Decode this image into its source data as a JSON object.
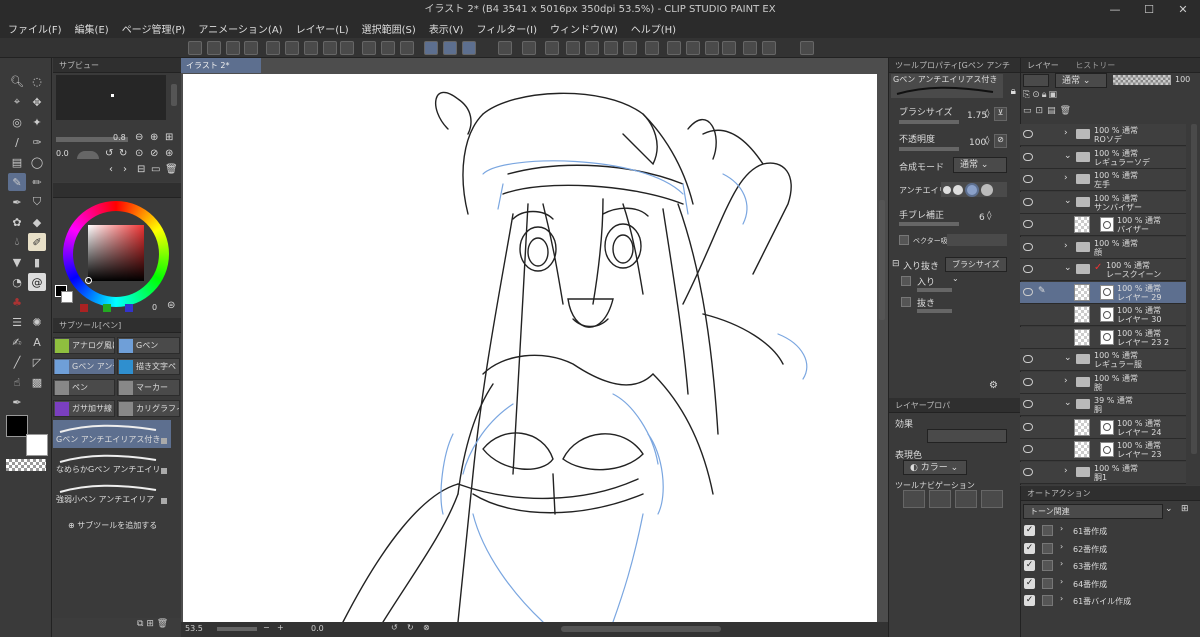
{
  "window": {
    "title": "イラスト 2* (B4 3541 x 5016px 350dpi 53.5%) - CLIP STUDIO PAINT EX",
    "minimize": "—",
    "maximize": "☐",
    "close": "✕"
  },
  "menu": [
    "ファイル(F)",
    "編集(E)",
    "ページ管理(P)",
    "アニメーション(A)",
    "レイヤー(L)",
    "選択範囲(S)",
    "表示(V)",
    "フィルター(I)",
    "ウィンドウ(W)",
    "ヘルプ(H)"
  ],
  "panels": {
    "subview": "サブビュー",
    "subtool": "サブツール[ペン]",
    "toolprop": "ツールプロパティ[Gペン アンチ",
    "layerprop": "レイヤープロパ",
    "layer_tab": "レイヤー",
    "history_tab": "ヒストリー",
    "autoaction": "オートアクション"
  },
  "document": {
    "tab": "イラスト 2*",
    "zoom": "53.5",
    "rotate": "0.0"
  },
  "navigator": {
    "zoom": "0.8",
    "rotate": "0.0"
  },
  "colors": {
    "main": "#000000",
    "sub": "#ffffff",
    "accent": "#5d6f8f",
    "palette_value": "0"
  },
  "subtool_groups": [
    {
      "label": "アナログ風に",
      "icon": "pen-icon",
      "color": "#8fbf3f"
    },
    {
      "label": "Gペン",
      "icon": "pen-icon",
      "color": "#6f9fd8"
    },
    {
      "label": "Gペン アンチ",
      "icon": "pen-icon",
      "color": "#6f9fd8",
      "active": true
    },
    {
      "label": "描き文字ペ",
      "icon": "pen-icon",
      "color": "#2f8fcf"
    },
    {
      "label": "ペン",
      "icon": "pen-icon",
      "color": "#888888"
    },
    {
      "label": "マーカー",
      "icon": "marker-icon",
      "color": "#888888"
    },
    {
      "label": "ガサ加サ線",
      "icon": "pen-icon",
      "color": "#7a3fbf"
    },
    {
      "label": "カリグラフィ",
      "icon": "pen-icon",
      "color": "#888888"
    }
  ],
  "brushes": [
    {
      "label": "Gペン アンチエイリアス付き",
      "active": true
    },
    {
      "label": "なめらかGペン アンチエイリ"
    },
    {
      "label": "強弱小ペン アンチエイリア"
    }
  ],
  "add_subtool": "サブツールを追加する",
  "toolprop": {
    "preview_label": "Gペン アンチエイリアス付き",
    "brush_size_label": "ブラシサイズ",
    "brush_size": "1.75",
    "opacity_label": "不透明度",
    "opacity": "100",
    "blend_label": "合成モード",
    "blend": "通常",
    "antialias_label": "アンチエイリ",
    "stabil_label": "手ブレ補正",
    "stabil": "6",
    "vector_label": "ベクター吸",
    "taper_label": "入り抜き",
    "taper_mode": "ブラシサイズ",
    "in_label": "入り",
    "out_label": "抜き"
  },
  "layerprop": {
    "effect": "効果",
    "expression_label": "表現色",
    "expression": "カラー",
    "navi": "ツールナビゲーション"
  },
  "layer_header": {
    "blend": "通常",
    "opacity": "100"
  },
  "layers": [
    {
      "type": "folder",
      "pct": "100 % 通常",
      "name": "ROソデ",
      "eye": true,
      "indent": 0
    },
    {
      "type": "folder",
      "pct": "100 % 通常",
      "name": "レギュラーソデ",
      "eye": true,
      "indent": 0,
      "open": true
    },
    {
      "type": "folder",
      "pct": "100 % 通常",
      "name": "左手",
      "eye": true,
      "indent": 0
    },
    {
      "type": "folder",
      "pct": "100 % 通常",
      "name": "サンバイザー",
      "eye": true,
      "indent": 0,
      "open": true
    },
    {
      "type": "layer",
      "pct": "100 % 通常",
      "name": "バイザー",
      "eye": true,
      "indent": 1
    },
    {
      "type": "folder",
      "pct": "100 % 通常",
      "name": "顔",
      "eye": true,
      "indent": 0
    },
    {
      "type": "folder",
      "pct": "100 % 通常",
      "name": "レースクイーン",
      "eye": true,
      "indent": 0,
      "open": true,
      "mark": true
    },
    {
      "type": "layer",
      "pct": "100 % 通常",
      "name": "レイヤー 29",
      "eye": true,
      "indent": 1,
      "active": true
    },
    {
      "type": "layer",
      "pct": "100 % 通常",
      "name": "レイヤー 30",
      "eye": false,
      "indent": 1
    },
    {
      "type": "layer",
      "pct": "100 % 通常",
      "name": "レイヤー 23 2",
      "eye": false,
      "indent": 1
    },
    {
      "type": "folder",
      "pct": "100 % 通常",
      "name": "レギュラー服",
      "eye": true,
      "indent": 0,
      "open": true
    },
    {
      "type": "folder",
      "pct": "100 % 通常",
      "name": "腕",
      "eye": true,
      "indent": 0
    },
    {
      "type": "folder",
      "pct": "39 % 通常",
      "name": "胴",
      "eye": true,
      "indent": 0,
      "open": true
    },
    {
      "type": "layer",
      "pct": "100 % 通常",
      "name": "レイヤー 24",
      "eye": true,
      "indent": 1
    },
    {
      "type": "layer",
      "pct": "100 % 通常",
      "name": "レイヤー 23",
      "eye": true,
      "indent": 1
    },
    {
      "type": "folder",
      "pct": "100 % 通常",
      "name": "胴1",
      "eye": true,
      "indent": 0
    }
  ],
  "autoaction": {
    "set": "トーン関連",
    "items": [
      "61番作成",
      "62番作成",
      "63番作成",
      "64番作成",
      "61番バイル作成"
    ]
  }
}
